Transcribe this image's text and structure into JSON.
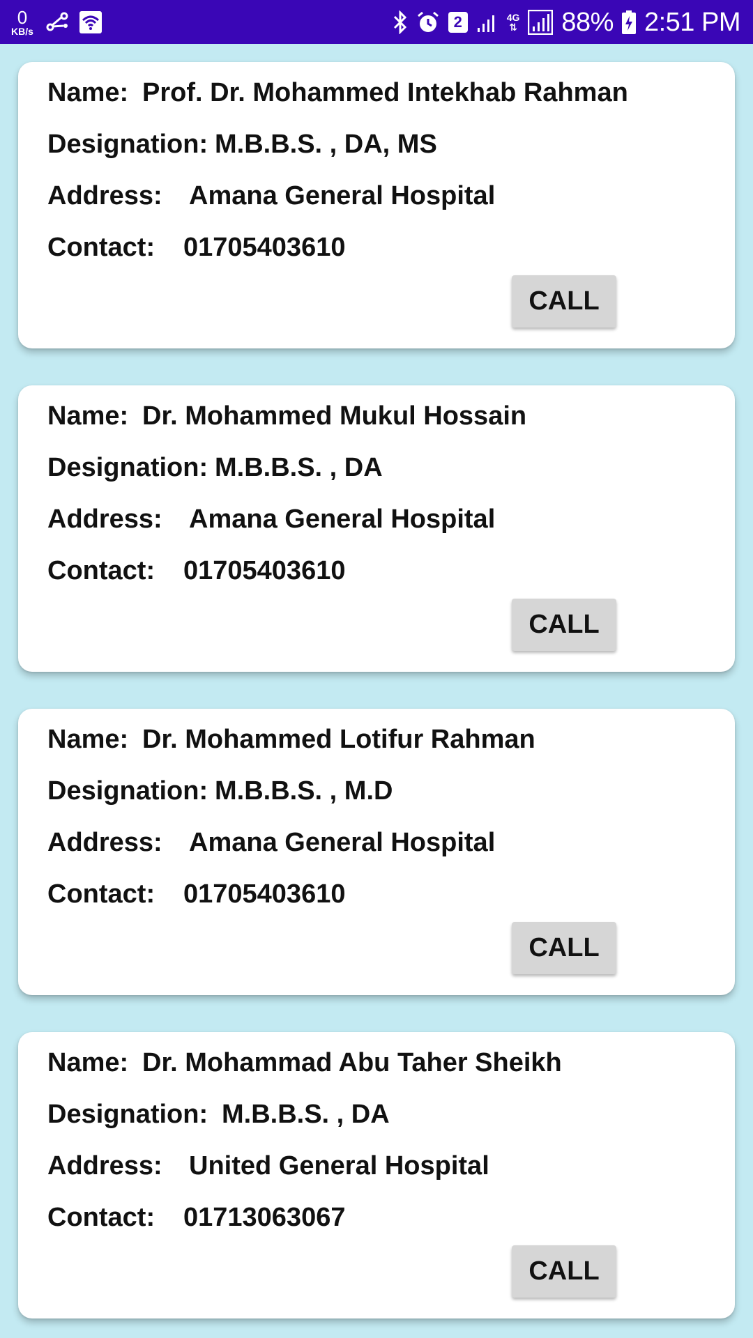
{
  "status_bar": {
    "net_speed_value": "0",
    "net_speed_unit": "KB/s",
    "sim_slot": "2",
    "network_type": "4G",
    "battery_percent": "88%",
    "time": "2:51 PM",
    "icons": [
      "usb-share-icon",
      "wifi-icon",
      "bluetooth-icon",
      "alarm-icon",
      "signal-icon",
      "battery-charging-icon"
    ]
  },
  "labels": {
    "name": "Name:",
    "designation": "Designation:",
    "address": "Address:",
    "contact": "Contact:",
    "call": "CALL"
  },
  "doctors": [
    {
      "name": "Prof. Dr. Mohammed Intekhab Rahman",
      "designation": "M.B.B.S. , DA, MS",
      "address": "Amana General Hospital",
      "contact": "01705403610"
    },
    {
      "name": "Dr. Mohammed Mukul Hossain",
      "designation": "M.B.B.S. , DA",
      "address": "Amana General Hospital",
      "contact": "01705403610"
    },
    {
      "name": "Dr. Mohammed Lotifur Rahman",
      "designation": "M.B.B.S. , M.D",
      "address": "Amana General Hospital",
      "contact": "01705403610"
    },
    {
      "name": "Dr. Mohammad Abu Taher Sheikh",
      "designation": "M.B.B.S. , DA",
      "address": "United General Hospital",
      "contact": "01713063067"
    }
  ],
  "colors": {
    "status_bar": "#3a06b6",
    "background": "#c3eaf2",
    "card": "#ffffff",
    "button": "#d6d6d6"
  }
}
